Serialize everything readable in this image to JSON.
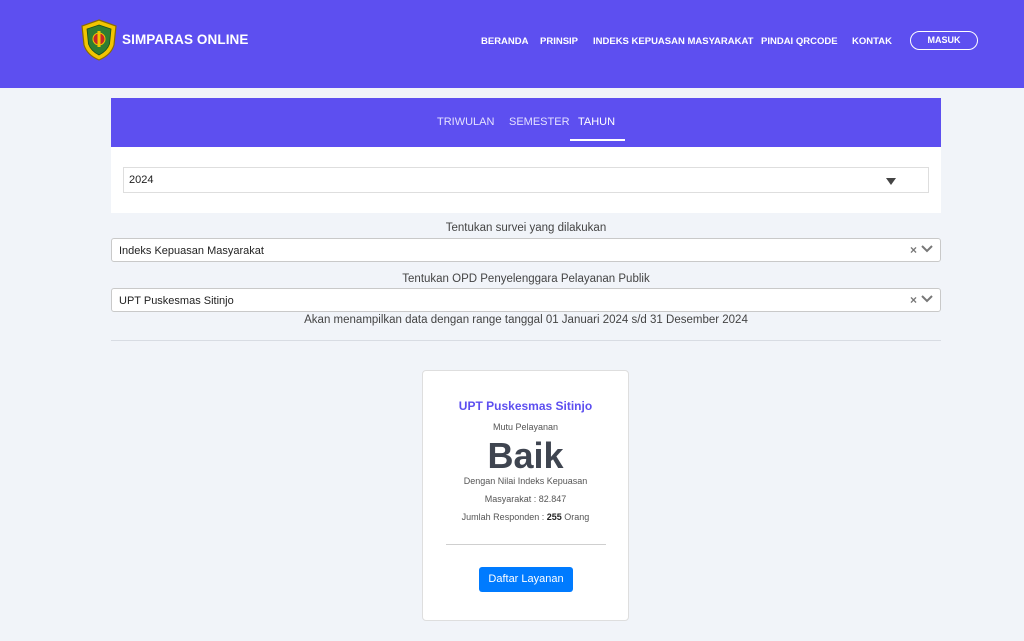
{
  "header": {
    "brand": "SIMPARAS ONLINE",
    "nav": [
      "BERANDA",
      "PRINSIP",
      "INDEKS KEPUASAN MASYARAKAT",
      "PINDAI QRCODE",
      "KONTAK"
    ],
    "login_label": "MASUK",
    "logo_icon": "coat-of-arms-shield-icon",
    "colors": {
      "primary": "#5d4ff0",
      "button": "#007bff"
    }
  },
  "period_tabs": {
    "items": [
      "TRIWULAN",
      "SEMESTER",
      "TAHUN"
    ],
    "active": "TAHUN"
  },
  "year_select": {
    "value": "2024"
  },
  "survey": {
    "label": "Tentukan survei yang dilakukan",
    "value": "Indeks Kepuasan Masyarakat"
  },
  "opd": {
    "label": "Tentukan OPD Penyelenggara Pelayanan Publik",
    "value": "UPT Puskesmas Sitinjo"
  },
  "range_text": "Akan menampilkan data dengan range tanggal 01 Januari 2024 s/d 31 Desember 2024",
  "result": {
    "unit": "UPT Puskesmas Sitinjo",
    "quality_label": "Mutu Pelayanan",
    "quality_value": "Baik",
    "index_line1": "Dengan Nilai Indeks Kepuasan",
    "index_line2": "Masyarakat : 82.847",
    "respondents_prefix": "Jumlah Responden :",
    "respondents_count": "255",
    "respondents_suffix": "Orang",
    "button_label": "Daftar Layanan"
  }
}
